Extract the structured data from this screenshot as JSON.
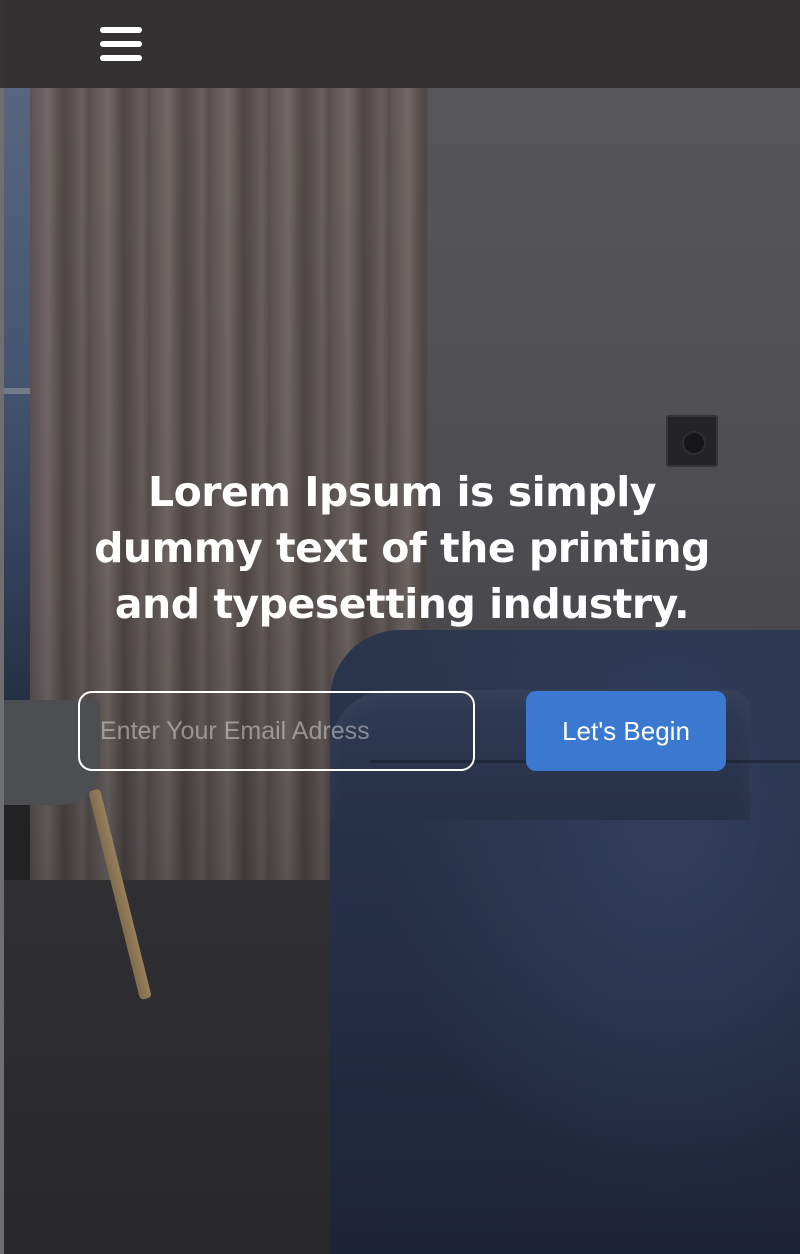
{
  "header": {
    "menu_icon": "hamburger-menu-icon"
  },
  "hero": {
    "title": "Lorem Ipsum is simply dummy text of the printing and typesetting industry.",
    "email_placeholder": "Enter Your Email Adress",
    "email_value": "",
    "cta_label": "Let's Begin"
  },
  "colors": {
    "cta_background": "#3a79cf",
    "topbar_background": "#343232",
    "text": "#ffffff"
  }
}
